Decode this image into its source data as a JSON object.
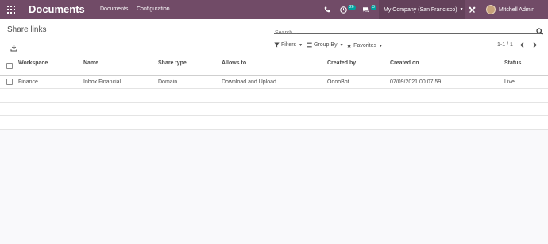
{
  "topbar": {
    "app_title": "Documents",
    "menu": [
      "Documents",
      "Configuration"
    ],
    "activity_count": "26",
    "message_count": "3",
    "company": "My Company (San Francisco)",
    "user": "Mitchell Admin",
    "colors": {
      "brand": "#714b67",
      "badge": "#00a09d"
    }
  },
  "control": {
    "breadcrumb": "Share links",
    "search_placeholder": "Search...",
    "filters_label": "Filters",
    "groupby_label": "Group By",
    "favorites_label": "Favorites",
    "pager": "1-1 / 1"
  },
  "table": {
    "columns": [
      "Workspace",
      "Name",
      "Share type",
      "Allows to",
      "Created by",
      "Created on",
      "Status"
    ],
    "rows": [
      {
        "workspace": "Finance",
        "name": "Inbox Financial",
        "share_type": "Domain",
        "allows_to": "Download and Upload",
        "created_by": "OdooBot",
        "created_on": "07/09/2021 00:07:59",
        "status": "Live"
      }
    ]
  }
}
